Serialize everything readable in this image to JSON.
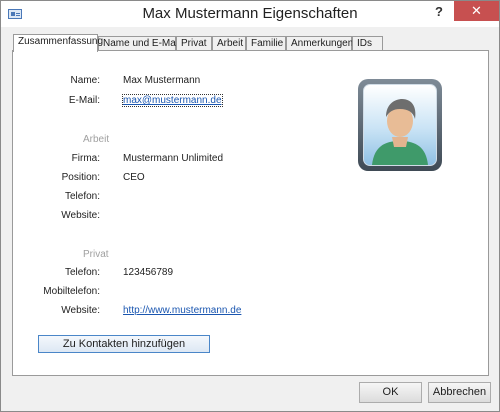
{
  "window": {
    "title": "Max Mustermann Eigenschaften",
    "help_label": "?",
    "close_label": "✕"
  },
  "tabs": [
    {
      "label": "Zusammenfassung"
    },
    {
      "label": "Name und E-Mail"
    },
    {
      "label": "Privat"
    },
    {
      "label": "Arbeit"
    },
    {
      "label": "Familie"
    },
    {
      "label": "Anmerkungen"
    },
    {
      "label": "IDs"
    }
  ],
  "summary": {
    "name_label": "Name:",
    "name_value": "Max Mustermann",
    "email_label": "E-Mail:",
    "email_value": "max@mustermann.de",
    "work_section": "Arbeit",
    "company_label": "Firma:",
    "company_value": "Mustermann Unlimited",
    "position_label": "Position:",
    "position_value": "CEO",
    "work_phone_label": "Telefon:",
    "work_website_label": "Website:",
    "private_section": "Privat",
    "phone_label": "Telefon:",
    "phone_value": "123456789",
    "mobile_label": "Mobiltelefon:",
    "private_website_label": "Website:",
    "private_website_value": "http://www.mustermann.de",
    "add_contact_label": "Zu Kontakten hinzufügen"
  },
  "footer": {
    "ok_label": "OK",
    "cancel_label": "Abbrechen"
  },
  "colors": {
    "close_button": "#c75050",
    "link": "#1a56b0",
    "avatar_shirt": "#3f9a6a"
  },
  "icons": {
    "app": "contact-card-icon",
    "avatar": "person-avatar-icon"
  }
}
